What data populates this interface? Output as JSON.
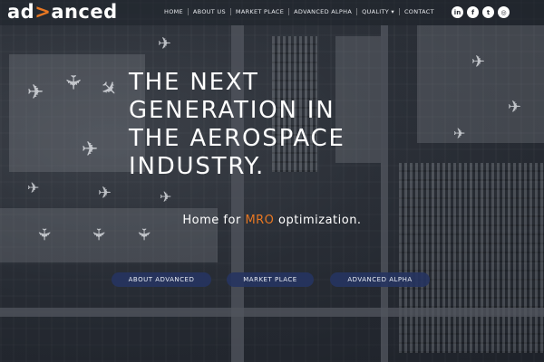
{
  "header": {
    "logo_text_pre": "ad",
    "logo_chevron": ">",
    "logo_text_post": "anced",
    "nav": [
      "HOME",
      "ABOUT US",
      "MARKET PLACE",
      "ADVANCED ALPHA",
      "QUALITY ▾",
      "CONTACT"
    ],
    "social": [
      {
        "icon": "linkedin-icon",
        "glyph": "in"
      },
      {
        "icon": "facebook-icon",
        "glyph": "f"
      },
      {
        "icon": "twitter-icon",
        "glyph": "t"
      },
      {
        "icon": "instagram-icon",
        "glyph": "◎"
      }
    ]
  },
  "hero": {
    "headline": "THE NEXT\nGENERATION IN\nTHE AEROSPACE\nINDUSTRY.",
    "tagline_pre": "Home for ",
    "tagline_accent": "MRO",
    "tagline_post": " optimization.",
    "buttons": [
      "ABOUT ADVANCED",
      "MARKET PLACE",
      "ADVANCED ALPHA"
    ]
  },
  "colors": {
    "accent": "#e87722",
    "button_bg": "#263460",
    "text": "#ffffff"
  }
}
